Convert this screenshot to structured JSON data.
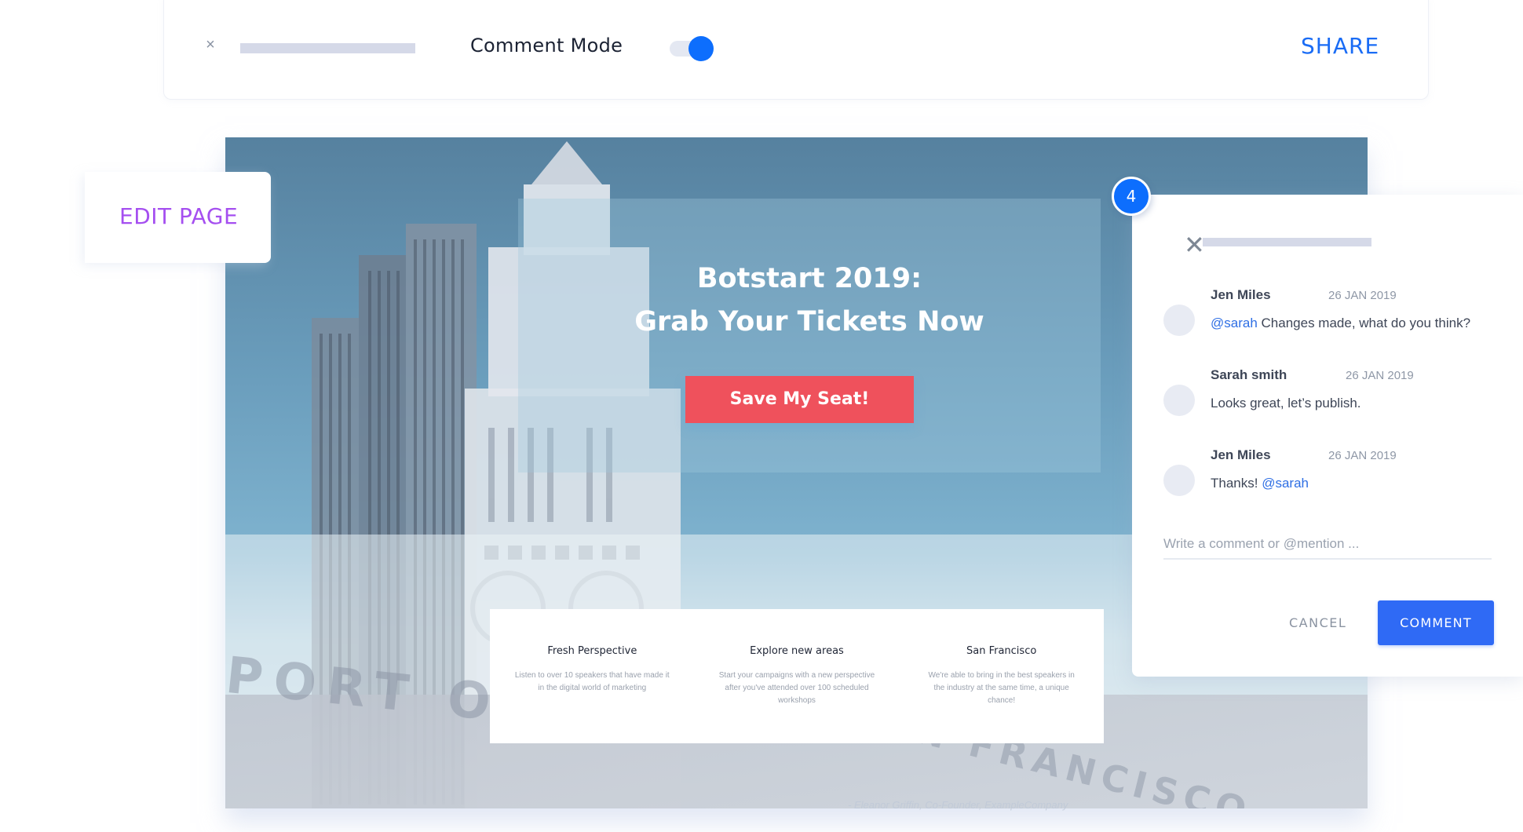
{
  "topbar": {
    "close_icon": "×",
    "mode_label": "Comment Mode",
    "comment_mode_on": true,
    "share_label": "SHARE"
  },
  "colors": {
    "accent_blue": "#0d6efd",
    "share_blue": "#1a6cf5",
    "edit_purple": "#a54ff0",
    "cta_red": "#ef515c",
    "comment_button": "#2f6af5",
    "mention": "#2f6fe4"
  },
  "edit_page": {
    "label": "EDIT PAGE"
  },
  "hero": {
    "headline_line1": "Botstart 2019:",
    "headline_line2": "Grab Your Tickets Now",
    "cta_label": "Save My Seat!",
    "sign_left": "PORT OF",
    "sign_right": "SAN FRANCISCO",
    "quote": "- Eleanor Griffin, Co-Founder, ExampleCompany"
  },
  "features": [
    {
      "title": "Fresh Perspective",
      "text": "Listen to over 10 speakers that have made it in the digital world of marketing"
    },
    {
      "title": "Explore new areas",
      "text": "Start your campaigns with a new perspective after you've attended over 100 scheduled workshops"
    },
    {
      "title": "San Francisco",
      "text": "We're able to bring in the best speakers in the industry at the same time, a unique chance!"
    }
  ],
  "comments_panel": {
    "badge_count": "4",
    "close_icon": "✕",
    "comments": [
      {
        "author": "Jen Miles",
        "date": "26 JAN 2019",
        "mention_prefix": "@sarah",
        "text": " Changes made, what do you think?",
        "mention_suffix": ""
      },
      {
        "author": "Sarah smith",
        "date": "26 JAN 2019",
        "mention_prefix": "",
        "text": "Looks great, let’s publish.",
        "mention_suffix": ""
      },
      {
        "author": "Jen Miles",
        "date": "26 JAN 2019",
        "mention_prefix": "",
        "text": "Thanks! ",
        "mention_suffix": "@sarah"
      }
    ],
    "input_placeholder": "Write a comment or @mention ...",
    "input_value": "",
    "cancel_label": "CANCEL",
    "submit_label": "COMMENT"
  }
}
